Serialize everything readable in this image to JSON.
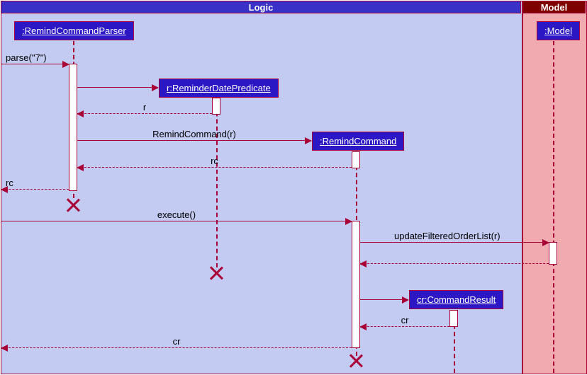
{
  "partitions": {
    "logic": {
      "title": "Logic"
    },
    "model": {
      "title": "Model"
    }
  },
  "participants": {
    "remindCommandParser": {
      "label": ":RemindCommandParser"
    },
    "reminderDatePredicate": {
      "label": "r:ReminderDatePredicate"
    },
    "remindCommand": {
      "label": ":RemindCommand"
    },
    "commandResult": {
      "label": "cr:CommandResult"
    },
    "model": {
      "label": ":Model"
    }
  },
  "messages": {
    "parse": "parse(\"7\")",
    "return_r": "r",
    "create_rc": "RemindCommand(r)",
    "return_rc": "rc",
    "return_rc_out": "rc",
    "execute": "execute()",
    "updateFiltered": "updateFilteredOrderList(r)",
    "return_cr": "cr",
    "return_cr_out": "cr"
  },
  "chart_data": {
    "type": "sequence_diagram",
    "partitions": [
      {
        "name": "Logic",
        "participants": [
          "RemindCommandParser",
          "ReminderDatePredicate",
          "RemindCommand",
          "CommandResult"
        ]
      },
      {
        "name": "Model",
        "participants": [
          "Model"
        ]
      }
    ],
    "lifelines": [
      {
        "id": "RemindCommandParser",
        "label": ":RemindCommandParser",
        "destroyed": true
      },
      {
        "id": "ReminderDatePredicate",
        "label": "r:ReminderDatePredicate",
        "created_by": "RemindCommandParser",
        "destroyed": true
      },
      {
        "id": "RemindCommand",
        "label": ":RemindCommand",
        "created_by": "RemindCommandParser",
        "destroyed": true
      },
      {
        "id": "CommandResult",
        "label": "cr:CommandResult",
        "created_by": "RemindCommand"
      },
      {
        "id": "Model",
        "label": ":Model"
      }
    ],
    "messages": [
      {
        "from": "caller",
        "to": "RemindCommandParser",
        "label": "parse(\"7\")",
        "type": "call"
      },
      {
        "from": "RemindCommandParser",
        "to": "ReminderDatePredicate",
        "label": "",
        "type": "create"
      },
      {
        "from": "ReminderDatePredicate",
        "to": "RemindCommandParser",
        "label": "r",
        "type": "return"
      },
      {
        "from": "RemindCommandParser",
        "to": "RemindCommand",
        "label": "RemindCommand(r)",
        "type": "create"
      },
      {
        "from": "RemindCommand",
        "to": "RemindCommandParser",
        "label": "rc",
        "type": "return"
      },
      {
        "from": "RemindCommandParser",
        "to": "caller",
        "label": "rc",
        "type": "return"
      },
      {
        "note": "RemindCommandParser destroyed"
      },
      {
        "from": "caller",
        "to": "RemindCommand",
        "label": "execute()",
        "type": "call"
      },
      {
        "from": "RemindCommand",
        "to": "Model",
        "label": "updateFilteredOrderList(r)",
        "type": "call"
      },
      {
        "from": "Model",
        "to": "RemindCommand",
        "label": "",
        "type": "return"
      },
      {
        "note": "ReminderDatePredicate destroyed"
      },
      {
        "from": "RemindCommand",
        "to": "CommandResult",
        "label": "",
        "type": "create"
      },
      {
        "from": "CommandResult",
        "to": "RemindCommand",
        "label": "cr",
        "type": "return"
      },
      {
        "from": "RemindCommand",
        "to": "caller",
        "label": "cr",
        "type": "return"
      },
      {
        "note": "RemindCommand destroyed"
      }
    ]
  }
}
